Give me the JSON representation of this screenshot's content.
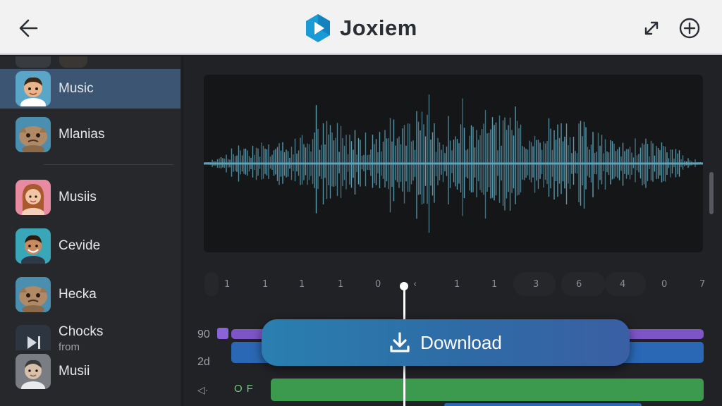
{
  "app": {
    "name": "Joxiem",
    "brand_color": "#1a9ad6"
  },
  "header": {
    "back_icon": "arrow-left-icon",
    "expand_icon": "expand-diagonal-icon",
    "add_icon": "plus-circle-icon"
  },
  "sidebar": {
    "items": [
      {
        "label": "Music",
        "avatar": "boy-avatar",
        "active": true
      },
      {
        "label": "Mlanias",
        "avatar": "creature-avatar",
        "active": false
      },
      {
        "label": "Musiis",
        "avatar": "woman-avatar",
        "active": false
      },
      {
        "label": "Cevide",
        "avatar": "smiling-man-avatar",
        "active": false
      },
      {
        "label": "Hecka",
        "avatar": "creature-avatar",
        "active": false
      },
      {
        "label": "Chocks",
        "sublabel": "from",
        "avatar": "play-icon",
        "active": false
      },
      {
        "label": "Musii",
        "avatar": "gray-man-avatar",
        "active": false
      }
    ]
  },
  "timeline": {
    "ruler_ticks": [
      "1",
      "1",
      "1",
      "1",
      "0",
      "‹",
      "1",
      "1",
      "3",
      "6",
      "4",
      "0",
      "7"
    ],
    "track_labels": [
      "90",
      "2d"
    ],
    "green_track_text": "OF",
    "colors": {
      "purple": "#7d55c7",
      "blue": "#2a68b5",
      "green": "#3c9a4e"
    }
  },
  "download": {
    "label": "Download",
    "icon": "download-icon"
  },
  "waveform": {
    "color": "#5fa3b8"
  }
}
